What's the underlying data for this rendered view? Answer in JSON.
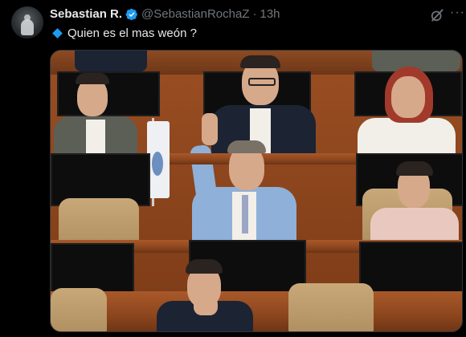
{
  "tweet": {
    "author_name": "Sebastian R.",
    "handle": "@SebastianRochaZ",
    "separator": "·",
    "time": "13h",
    "text": "Quien es el mas weón ?",
    "more_icon": "···"
  },
  "icons": {
    "verified": "verified-badge-icon",
    "grok": "grok-icon",
    "more": "more-options-icon",
    "bullet": "blue-diamond-emoji"
  },
  "colors": {
    "background": "#000000",
    "primary_text": "#e7e9ea",
    "secondary_text": "#71767b",
    "accent": "#1d9bf0"
  }
}
